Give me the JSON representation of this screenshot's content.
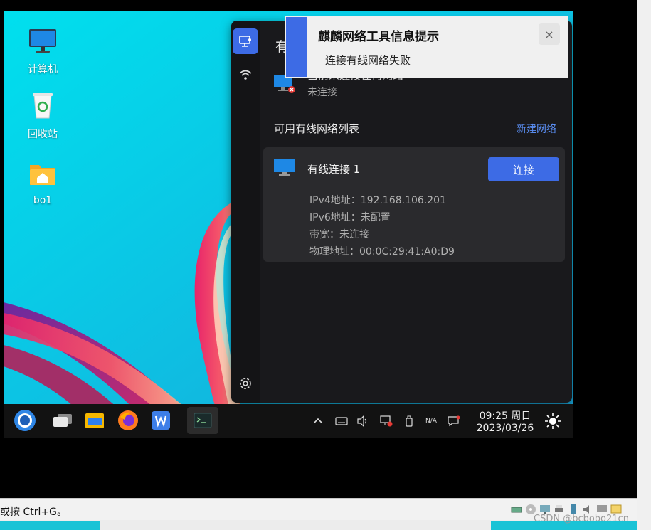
{
  "desktop": {
    "icons": [
      {
        "label": "计算机",
        "icon": "computer-icon"
      },
      {
        "label": "回收站",
        "icon": "trash-icon"
      },
      {
        "label": "bo1",
        "icon": "home-folder-icon"
      }
    ]
  },
  "network_panel": {
    "title": "有线网络",
    "current": {
      "name": "当前未连接任何网络",
      "status": "未连接"
    },
    "available_title": "可用有线网络列表",
    "new_network": "新建网络",
    "connection": {
      "name": "有线连接 1",
      "connect_label": "连接",
      "ipv4": "IPv4地址：192.168.106.201",
      "ipv6": "IPv6地址：未配置",
      "bandwidth": "带宽：未连接",
      "mac": "物理地址：00:0C:29:41:A0:D9"
    }
  },
  "notification": {
    "title": "麒麟网络工具信息提示",
    "message": "连接有线网络失败",
    "close": "×"
  },
  "taskbar": {
    "apps": [
      "start-menu-icon",
      "multitask-view-icon",
      "file-manager-icon",
      "firefox-icon",
      "wps-icon",
      "terminal-icon"
    ],
    "tray": {
      "na": "N/A"
    },
    "time": "09:25 周日",
    "date": "2023/03/26"
  },
  "host": {
    "hint": "或按 Ctrl+G。",
    "watermark": "CSDN @bcbobo21cn"
  },
  "colors": {
    "accent": "#3d6be5",
    "panel_bg": "#19191c",
    "card_bg": "#2a2a2d",
    "desktop_bg": "#1ed5e4"
  }
}
